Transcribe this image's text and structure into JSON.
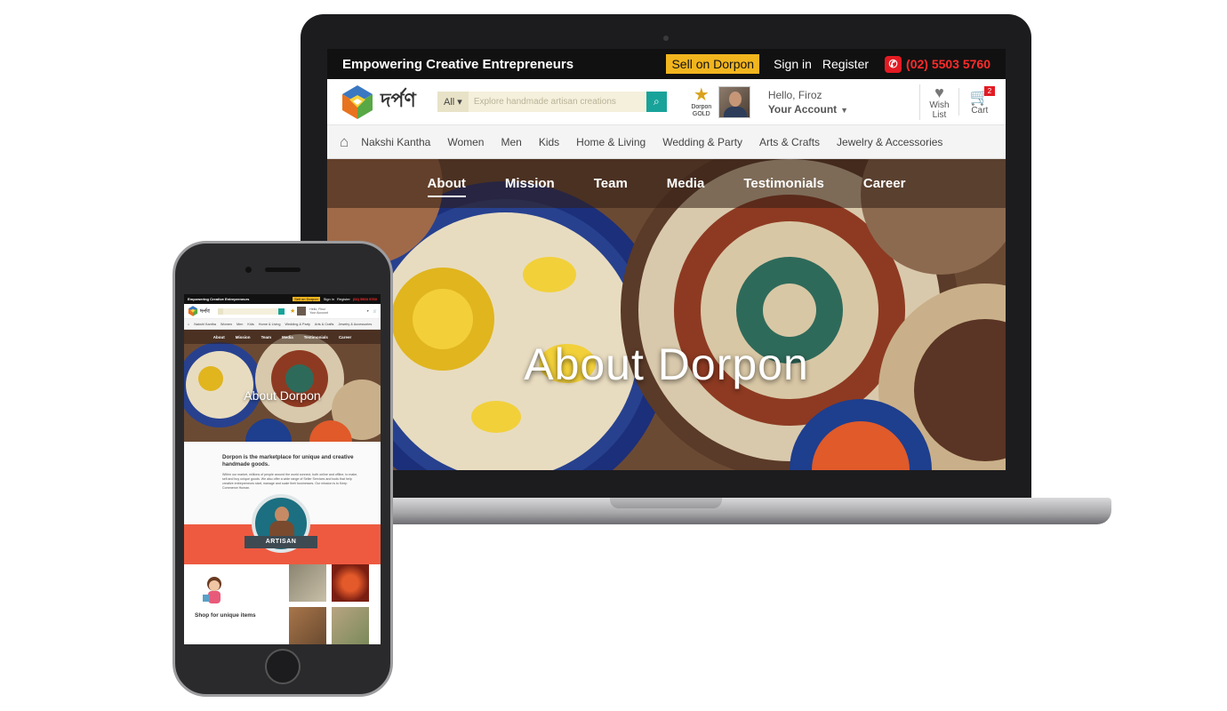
{
  "desktop": {
    "topbar": {
      "tagline": "Empowering Creative Entrepreneurs",
      "sell_label": "Sell on Dorpon",
      "signin_label": "Sign in",
      "register_label": "Register",
      "phone": "(02) 5503 5760"
    },
    "header": {
      "logo_text": "দর্পণ",
      "search": {
        "category": "All",
        "placeholder": "Explore handmade artisan creations"
      },
      "gold_badge": {
        "line1": "Dorpon",
        "line2": "GOLD"
      },
      "account": {
        "greeting": "Hello, Firoz",
        "label": "Your Account"
      },
      "wishlist": {
        "line1": "Wish",
        "line2": "List"
      },
      "cart": {
        "label": "Cart",
        "count": "2"
      }
    },
    "categories": [
      "Nakshi Kantha",
      "Women",
      "Men",
      "Kids",
      "Home & Living",
      "Wedding & Party",
      "Arts & Crafts",
      "Jewelry & Accessories"
    ],
    "about_nav": [
      "About",
      "Mission",
      "Team",
      "Media",
      "Testimonials",
      "Career"
    ],
    "about_nav_active": "About",
    "hero_title": "About Dorpon"
  },
  "mobile": {
    "topbar": {
      "tagline": "Empowering Creative Entrepreneurs",
      "sell_label": "Sell on Dorpon",
      "signin_label": "Sign in",
      "register_label": "Register",
      "phone": "(02) 5503 5760"
    },
    "account": {
      "greeting": "Hello, Firoz",
      "label": "Your Account"
    },
    "categories": [
      "Nakshi Kantha",
      "Women",
      "Men",
      "Kids",
      "Home & Living",
      "Wedding & Party",
      "Arts & Crafts",
      "Jewelry & Accessories"
    ],
    "about_nav": [
      "About",
      "Mission",
      "Team",
      "Media",
      "Testimonials",
      "Career"
    ],
    "hero_title": "About Dorpon",
    "intro_heading": "Dorpon is the marketplace for unique and creative handmade goods.",
    "intro_body": "Within our market, millions of people around the world connect, both online and offline, to make, sell and buy unique goods. We also offer a wide range of Seller Services and tools that help creative entrepreneurs start, manage and scale their businesses. Our mission is to Keep Commerce Human.",
    "badge_label": "ARTISAN",
    "shop_title": "Shop for unique items"
  },
  "colors": {
    "accent_yellow": "#f2b51e",
    "phone_red": "#ff2b2b",
    "search_teal": "#18a39a",
    "band_orange": "#ee5a40"
  }
}
